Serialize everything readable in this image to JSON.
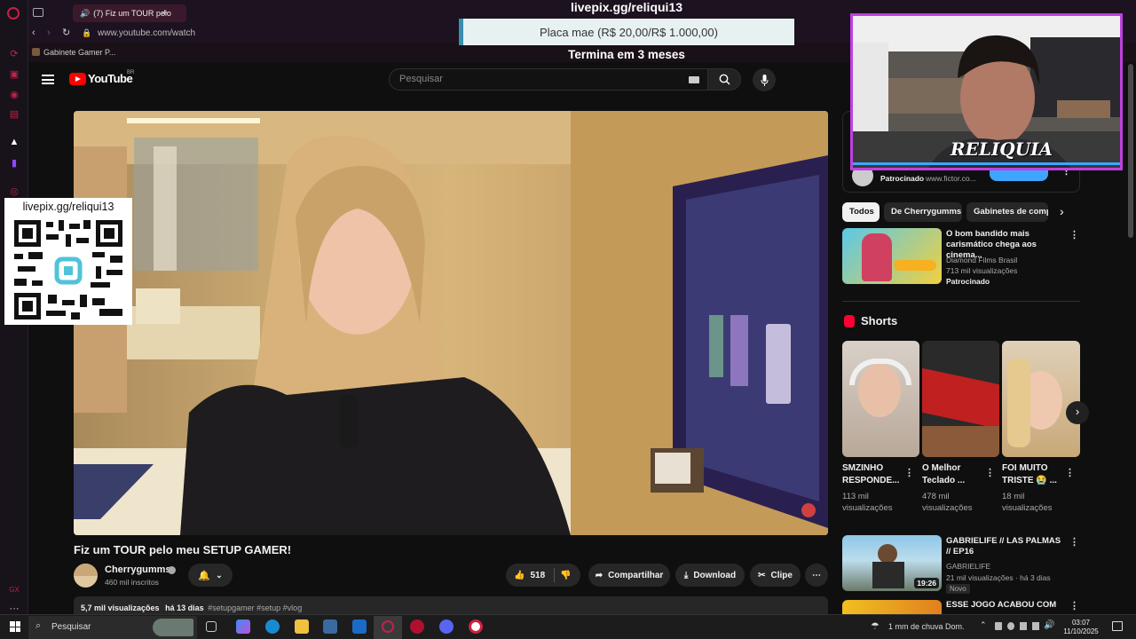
{
  "browser": {
    "tab_title": "(7) Fiz um TOUR pelo",
    "url": "www.youtube.com/watch",
    "bookmark": "Gabinete Gamer P..."
  },
  "stream_overlay": {
    "banner_title": "livepix.gg/reliqui13",
    "goal_label": "Placa mae (R$ 20,00/R$ 1.000,00)",
    "goal_deadline": "Termina em 3 meses",
    "qr_caption": "livepix.gg/reliqui13",
    "webcam_logo": "RELIQUIA"
  },
  "youtube": {
    "logo": "YouTube",
    "region": "BR",
    "search_placeholder": "Pesquisar",
    "video": {
      "title": "Fiz um TOUR pelo meu SETUP GAMER!",
      "channel": "Cherrygumms",
      "subscribers": "460 mil inscritos",
      "likes": "518",
      "share": "Compartilhar",
      "download": "Download",
      "clip": "Clipe",
      "views": "5,7 mil visualizações",
      "age": "há 13 dias",
      "tags": "#setupgamer #setup #vlog"
    },
    "sponsor_top": {
      "label": "Patrocinado",
      "domain": "www.fictor.co..."
    },
    "chips": [
      "Todos",
      "De Cherrygumms",
      "Gabinetes de comp"
    ],
    "ad_card": {
      "title": "O bom bandido mais carismático chega aos cinema...",
      "channel": "Diamond Films Brasil",
      "views": "713 mil visualizações",
      "label": "Patrocinado"
    },
    "shorts_heading": "Shorts",
    "shorts": [
      {
        "title": "SMZINHO RESPONDE...",
        "views": "113 mil visualizações"
      },
      {
        "title": "O Melhor Teclado ...",
        "views": "478 mil visualizações"
      },
      {
        "title": "FOI MUITO TRISTE 😭 ...",
        "views": "18 mil visualizações"
      }
    ],
    "recommended": [
      {
        "title": "GABRIELIFE // LAS PALMAS // EP16",
        "channel": "GABRIELIFE",
        "meta": "21 mil visualizações · há 3 dias",
        "badge": "Novo",
        "duration": "19:26"
      },
      {
        "title": "ESSE JOGO ACABOU COM A"
      }
    ]
  },
  "taskbar": {
    "search_placeholder": "Pesquisar",
    "weather": "1 mm de chuva Dom.",
    "time": "03:07",
    "date": "11/10/2025"
  },
  "colors": {
    "youtube_red": "#ff0000",
    "opera_red": "#c0224a",
    "webcam_border": "#c040e0",
    "goal_accent": "#3a8fb0"
  }
}
